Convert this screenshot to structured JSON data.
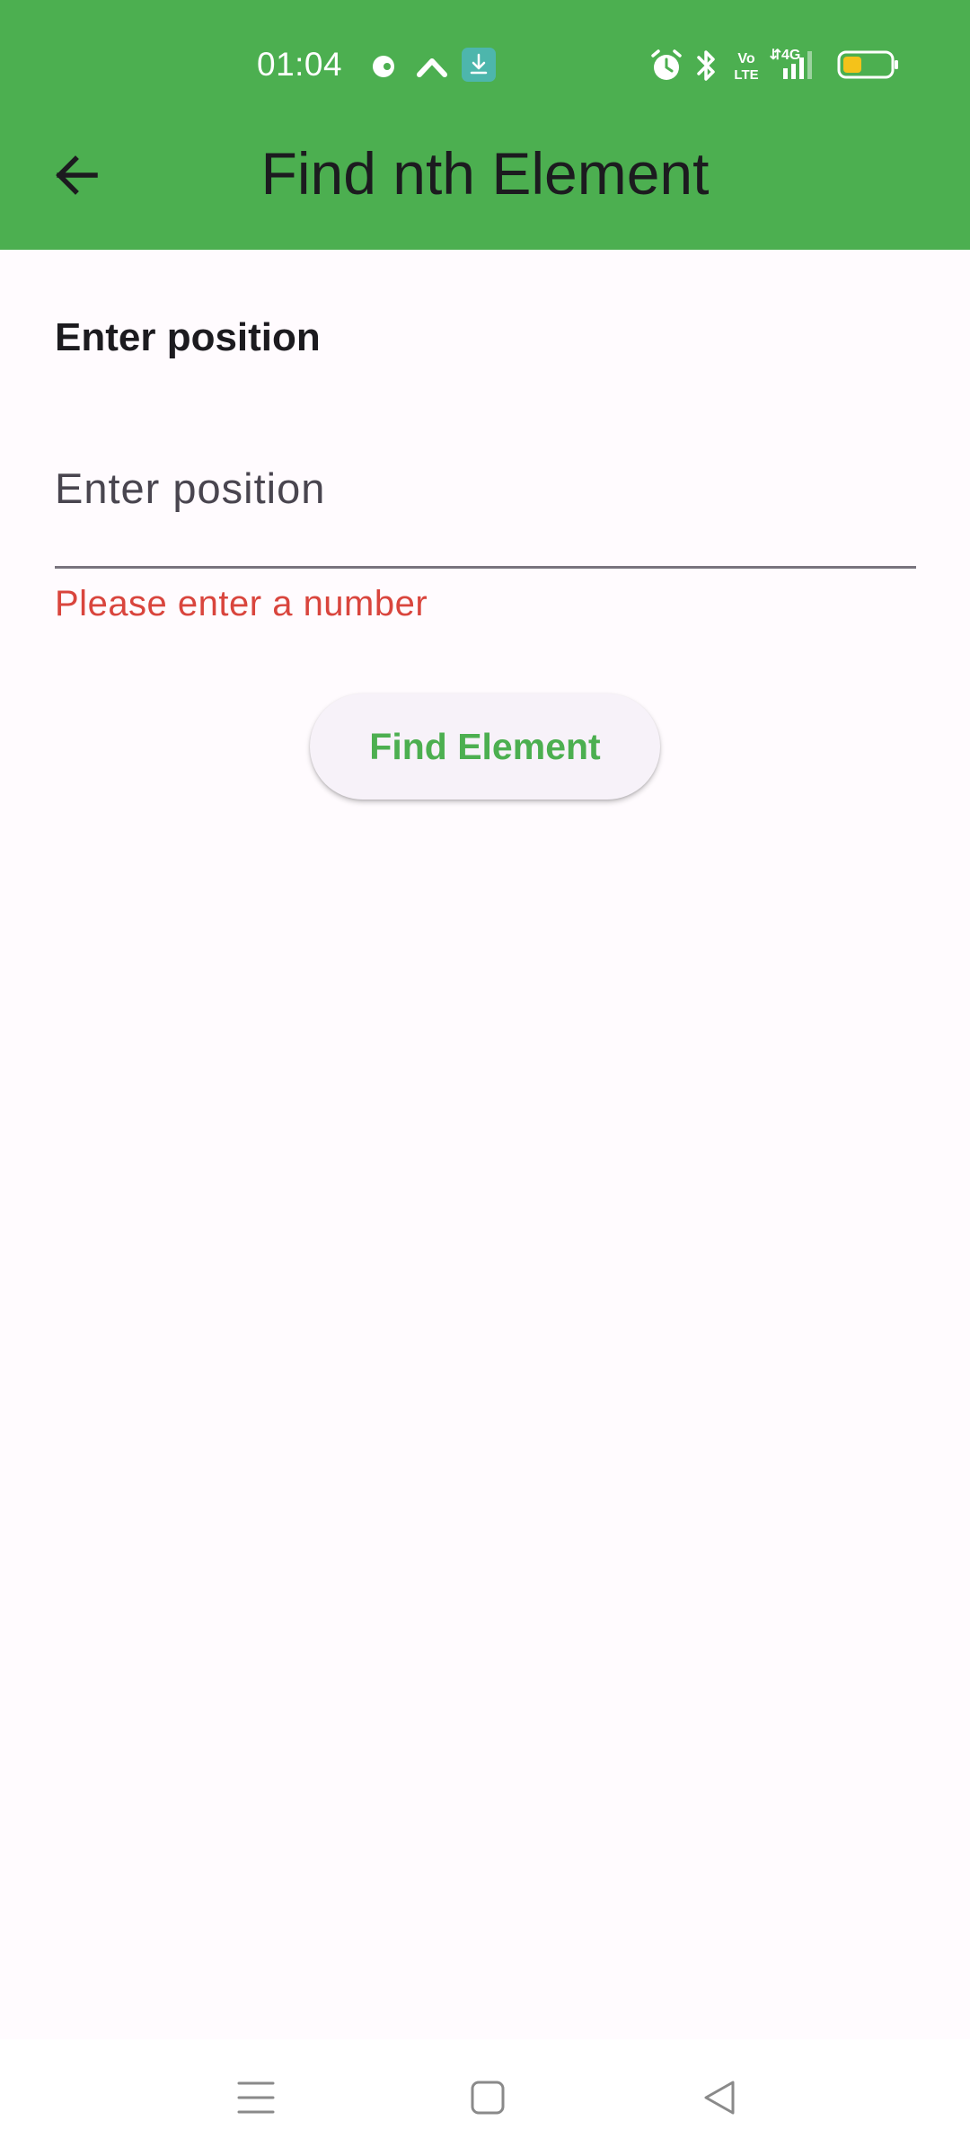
{
  "status_bar": {
    "time": "01:04",
    "icons": [
      "data-saver-icon",
      "chevron-up-icon",
      "download-icon",
      "alarm-icon",
      "bluetooth-icon",
      "volte-icon",
      "signal-4g-icon",
      "battery-icon"
    ],
    "volte_label": "Vo LTE",
    "network_label": "4G",
    "battery_level": 0.35
  },
  "app_bar": {
    "title": "Find nth Element",
    "back_icon": "arrow-back-icon",
    "color": "#4caf50"
  },
  "form": {
    "section_label": "Enter position",
    "input": {
      "value": "",
      "placeholder": "Enter position"
    },
    "error_text": "Please enter a number",
    "error_color": "#d9453d",
    "submit_label": "Find Element"
  },
  "nav_bar": {
    "icons": [
      "menu-icon",
      "home-square-icon",
      "back-triangle-icon"
    ]
  }
}
